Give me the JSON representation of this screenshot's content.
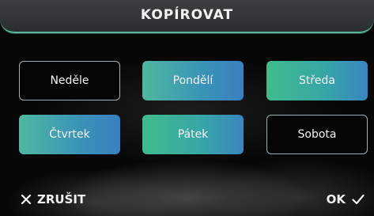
{
  "header": {
    "title": "KOPÍROVAT"
  },
  "days": [
    {
      "label": "Neděle",
      "selected": false
    },
    {
      "label": "Pondělí",
      "selected": true
    },
    {
      "label": "Středa",
      "selected": true
    },
    {
      "label": "Čtvrtek",
      "selected": true
    },
    {
      "label": "Pátek",
      "selected": true
    },
    {
      "label": "Sobota",
      "selected": false
    }
  ],
  "footer": {
    "cancel_label": "ZRUŠIT",
    "cancel_icon": "close-icon",
    "ok_label": "OK",
    "ok_icon": "check-icon"
  },
  "colors": {
    "accent": "#57b79a",
    "selected_gradient_start": "#4fb7a0",
    "selected_gradient_end": "#3a7fc0",
    "unselected_border": "#9fb0b8"
  }
}
